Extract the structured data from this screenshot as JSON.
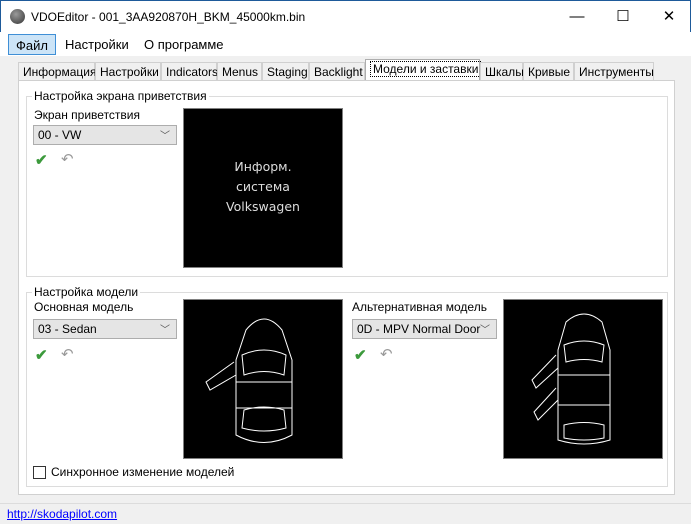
{
  "window": {
    "title": "VDOEditor - 001_3AA920870H_BKM_45000km.bin",
    "minimize": "—",
    "maximize": "☐",
    "close": "✕"
  },
  "menu": [
    "Файл",
    "Настройки",
    "О программе"
  ],
  "tabs": [
    "Информация",
    "Настройки",
    "Indicators",
    "Menus",
    "Staging",
    "Backlight",
    "Модели и заставки",
    "Шкалы",
    "Кривые",
    "Инструменты"
  ],
  "welcome": {
    "group_title": "Настройка экрана приветствия",
    "label": "Экран приветствия",
    "value": "00 - VW",
    "screen_lines": [
      "Информ.",
      "система",
      "Volkswagen"
    ]
  },
  "model": {
    "group_title": "Настройка модели",
    "main_label": "Основная модель",
    "main_value": "03 - Sedan",
    "alt_label": "Альтернативная модель",
    "alt_value": "0D - MPV Normal Door",
    "sync_label": "Синхронное изменение моделей",
    "sync_checked": false
  },
  "icons": {
    "apply": "✔",
    "undo": "↶"
  },
  "status": {
    "link": "http://skodapilot.com"
  }
}
